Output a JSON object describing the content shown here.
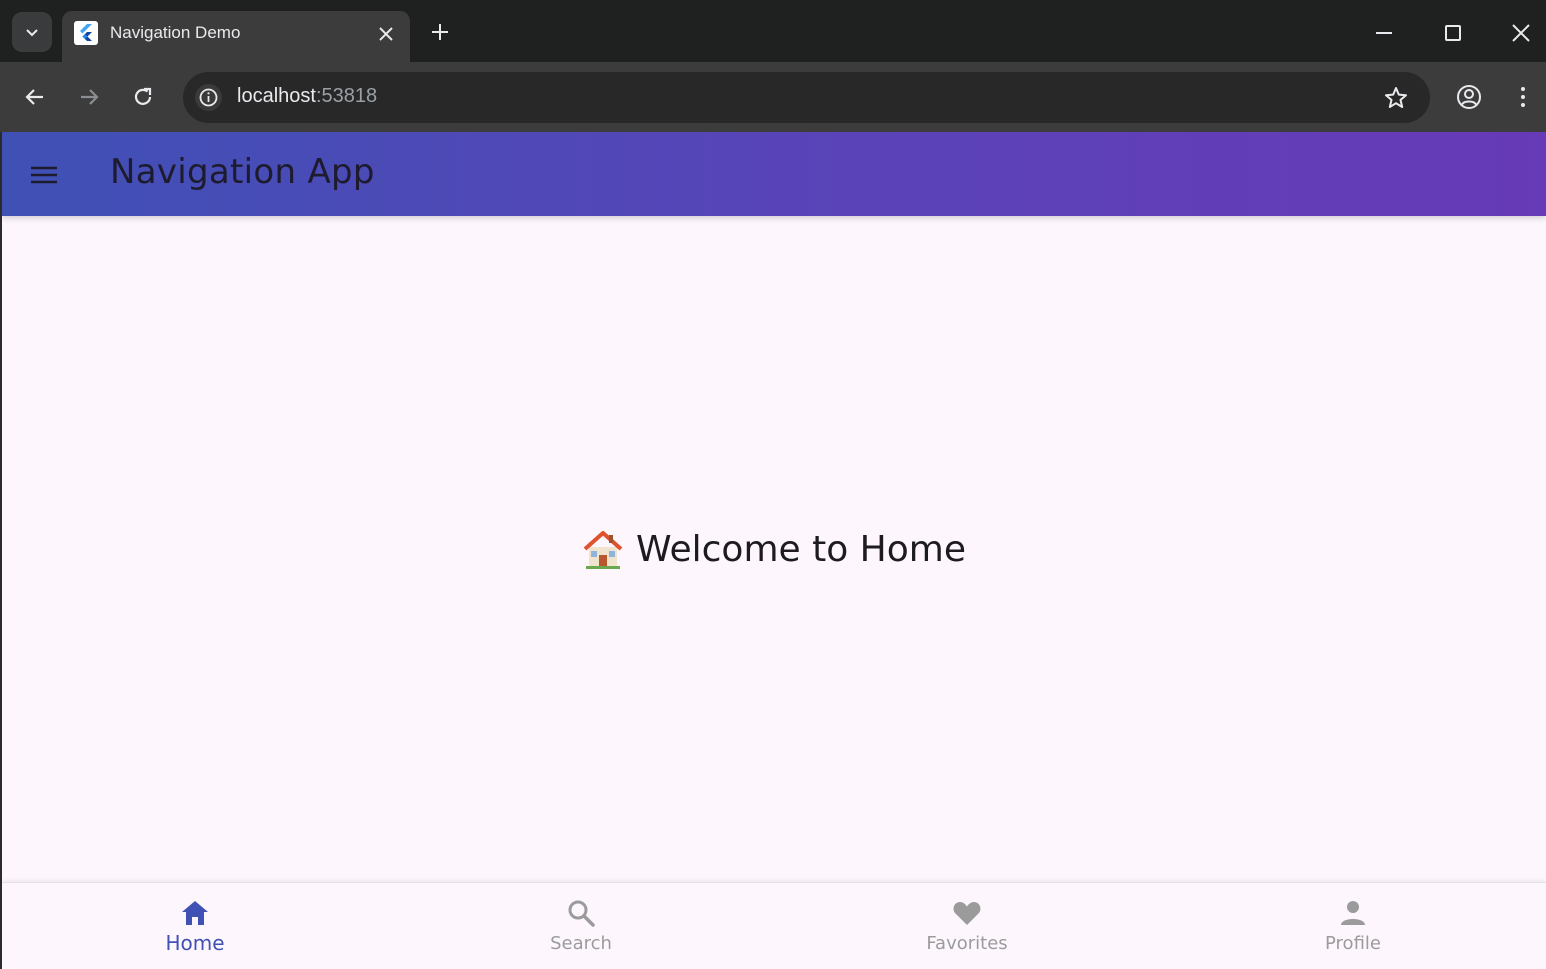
{
  "browser": {
    "tab": {
      "title": "Navigation Demo",
      "favicon": "flutter-icon"
    },
    "url": {
      "host": "localhost",
      "port": ":53818"
    },
    "icons": {
      "tab_search": "chevron-down-icon",
      "tab_close": "close-icon",
      "new_tab": "plus-icon",
      "minimize": "minimize-icon",
      "maximize": "maximize-icon",
      "close_window": "close-icon",
      "back": "arrow-left-icon",
      "forward": "arrow-right-icon",
      "reload": "reload-icon",
      "site_info": "info-icon",
      "bookmark": "star-icon",
      "profile": "account-circle-icon",
      "menu": "more-vert-icon"
    },
    "colors": {
      "tabstrip": "#1f2020",
      "toolbar": "#3c3c3c",
      "omnibox": "#282828"
    }
  },
  "app": {
    "appbar": {
      "title": "Navigation App",
      "menu_icon": "hamburger-menu-icon",
      "gradient_start": "#3f51b5",
      "gradient_end": "#673ab7"
    },
    "content": {
      "emoji_icon": "house-icon",
      "welcome_text": "Welcome to Home"
    },
    "bottom_nav": {
      "active_index": 0,
      "active_color": "#3f51b5",
      "inactive_color": "#9b9b9b",
      "items": [
        {
          "label": "Home",
          "icon": "home-icon"
        },
        {
          "label": "Search",
          "icon": "search-icon"
        },
        {
          "label": "Favorites",
          "icon": "heart-icon"
        },
        {
          "label": "Profile",
          "icon": "person-icon"
        }
      ]
    }
  }
}
